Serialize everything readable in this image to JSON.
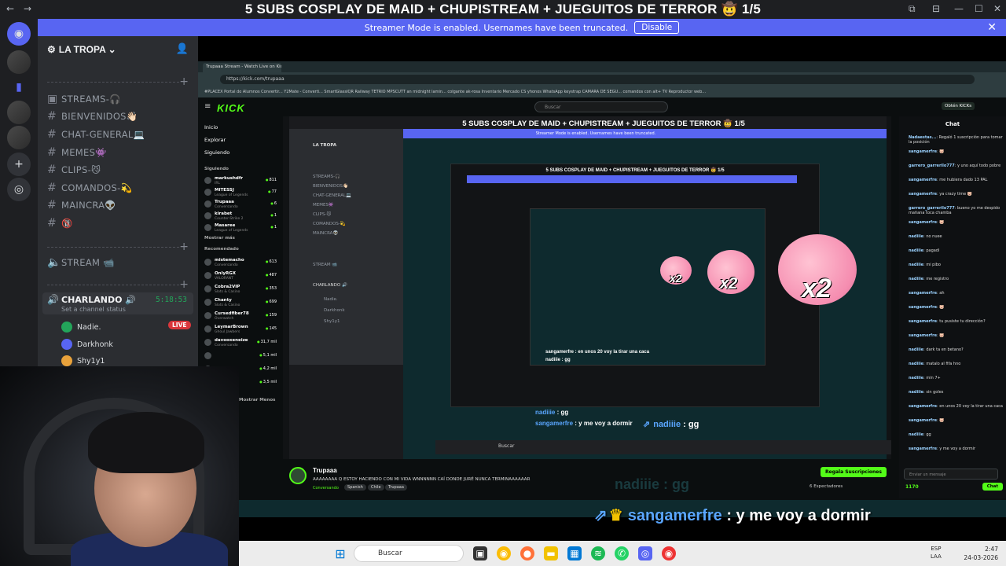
{
  "window": {
    "title": "5 SUBS COSPLAY DE MAID + CHUPISTREAM + JUEGUITOS DE TERROR 🤠 1/5",
    "controls": [
      "⧉",
      "⊟",
      "—",
      "☐",
      "✕"
    ]
  },
  "banner": {
    "text": "Streamer Mode is enabled. Usernames have been truncated.",
    "button": "Disable"
  },
  "server": {
    "name": "LA TROPA",
    "channels": [
      {
        "name": "STREAMS-🎧",
        "type": "text"
      },
      {
        "name": "BIENVENIDOS👋🏻",
        "type": "text"
      },
      {
        "name": "CHAT-GENERAL💻",
        "type": "text"
      },
      {
        "name": "MEMES👾",
        "type": "text"
      },
      {
        "name": "CLIPS-😼",
        "type": "text"
      },
      {
        "name": "COMANDOS-💫",
        "type": "text"
      },
      {
        "name": "MAINCRA👽",
        "type": "text"
      },
      {
        "name": "🔞",
        "type": "text"
      }
    ],
    "stream_channel": "STREAM 📹",
    "voice": {
      "name": "CHARLANDO 🔊",
      "timer": "5:18:53",
      "status": "Set a channel status",
      "members": [
        {
          "name": "Nadie.",
          "live": "LIVE"
        },
        {
          "name": "Darkhonk"
        },
        {
          "name": "Shy1y1"
        }
      ]
    }
  },
  "browser": {
    "tab": "Trupaaa Stream - Watch Live on Kick",
    "url": "https://kick.com/trupaaa",
    "bookmarks": "#PLACEX   Portal do Alumnos   Convertir...   Y2Mate - Converti...   SmartGlassIQR   Railway   TETRIO   MPSCUTT   an midnight lamin...   colgante ak-rosa   Inventario   Mercado CS   yhonos   WhatsApp   keystrap   CAMARA DE SEGU...   comandos con alt+   TV   Reproductor web..."
  },
  "kick": {
    "logo": "KICK",
    "search_placeholder": "Buscar",
    "login": "Obtén KICKs",
    "nav": [
      "Inicio",
      "Explorar",
      "Siguiendo"
    ],
    "following_label": "Siguiendo",
    "following": [
      {
        "name": "markushdfr",
        "game": "IRL",
        "viewers": "811"
      },
      {
        "name": "MITESSJ",
        "game": "League of Legends",
        "viewers": "77"
      },
      {
        "name": "Trupaaa",
        "game": "Conversando",
        "viewers": "6"
      },
      {
        "name": "kirabet",
        "game": "Counter-Strike 2",
        "viewers": "1"
      },
      {
        "name": "Masaree",
        "game": "League of Legends",
        "viewers": "1"
      }
    ],
    "show_more": "Mostrar más",
    "recommended_label": "Recomendado",
    "recommended": [
      {
        "name": "mistemacho",
        "game": "Conversando",
        "viewers": "613"
      },
      {
        "name": "OnlyRGX",
        "game": "VALORANT",
        "viewers": "487"
      },
      {
        "name": "Cobra2VIP",
        "game": "Slots & Casino",
        "viewers": "353"
      },
      {
        "name": "Chanty",
        "game": "Slots & Casino",
        "viewers": "699"
      },
      {
        "name": "Cursedfiber78",
        "game": "Overwatch",
        "viewers": "159"
      },
      {
        "name": "LeymarBrown",
        "game": "Ghoul Jawbers",
        "viewers": "145"
      },
      {
        "name": "davooxeneize",
        "game": "Conversando",
        "viewers": "31,7 mil"
      },
      {
        "name": "",
        "game": "",
        "viewers": "5,1 mil"
      },
      {
        "name": "",
        "game": "",
        "viewers": "4,2 mil"
      },
      {
        "name": "",
        "game": "",
        "viewers": "3,5 mil"
      }
    ],
    "show_less": "Mostrar Menos",
    "stream": {
      "streamer": "Trupaaa",
      "description": "AAAAAAAA Q ESTOY HACIENDO CON MI VIDA WNNNNNN CAÍ DONDE JURÉ NUNCA TERMINAAAAAAR",
      "category": "Conversando",
      "tags": [
        "Spanish",
        "Chile",
        "Trupaaa"
      ],
      "subscribe": "Regala Suscripciones",
      "viewers": "6 Espectadores"
    },
    "chat": {
      "title": "Chat",
      "messages": [
        {
          "user": "Nadaestas...",
          "text": "Regaló 1 suscripción para tomar la posición"
        },
        {
          "user": "sangamerfre",
          "text": "🐷"
        },
        {
          "user": "garrero_garrerilo777",
          "text": "y uno aquí todo pobre"
        },
        {
          "user": "sangamerfre",
          "text": "me hubiera dado 13 PAL"
        },
        {
          "user": "sangamerfre",
          "text": "ya crazy time 🐷"
        },
        {
          "user": "garrero_garrerilo777",
          "text": "bueno yo me despido mañana toca chamba"
        },
        {
          "user": "sangamerfre",
          "text": "🐷"
        },
        {
          "user": "nadiiie",
          "text": "no nuee"
        },
        {
          "user": "nadiiie",
          "text": "pagadi"
        },
        {
          "user": "nadiiie",
          "text": "mi pibo"
        },
        {
          "user": "nadiiie",
          "text": "me registro"
        },
        {
          "user": "sangamerfre",
          "text": "ah"
        },
        {
          "user": "sangamerfre",
          "text": "🐷"
        },
        {
          "user": "sangamerfre",
          "text": "tu pusiste tu dirección?"
        },
        {
          "user": "sangamerfre",
          "text": "🐷"
        },
        {
          "user": "nadiiie",
          "text": "dark ta en betano?"
        },
        {
          "user": "nadiiie",
          "text": "matalo al fifa hno"
        },
        {
          "user": "nadiiie",
          "text": "min 7+"
        },
        {
          "user": "nadiiie",
          "text": "sin goles"
        },
        {
          "user": "sangamerfre",
          "text": "en unos 20 voy la tirar una caca"
        },
        {
          "user": "sangamerfre",
          "text": "🐷"
        },
        {
          "user": "nadiiie",
          "text": "gg"
        },
        {
          "user": "sangamerfre",
          "text": "y me voy a dormir"
        }
      ],
      "input_placeholder": "Enviar un mensaje",
      "points": "1170",
      "send": "Chat"
    }
  },
  "overlay": {
    "ghost_line": "nadiiie : gg",
    "mid_line_1_user": "nadiiie",
    "mid_line_1_text": ": gg",
    "mid_line_2_user": "sangamerfre",
    "mid_line_2_text": ": y me voy a dormir",
    "deep_msg_1": "sangamerfre : en unos 20 voy la tirar una caca",
    "deep_msg_2": "nadiiie : gg",
    "big_user": "sangamerfre",
    "big_text": ": y me voy a dormir",
    "x2": "x2"
  },
  "taskbar": {
    "search": "Buscar",
    "lang_1": "ESP",
    "lang_2": "LAA",
    "time": "2:47",
    "date": "24-03-2026"
  }
}
